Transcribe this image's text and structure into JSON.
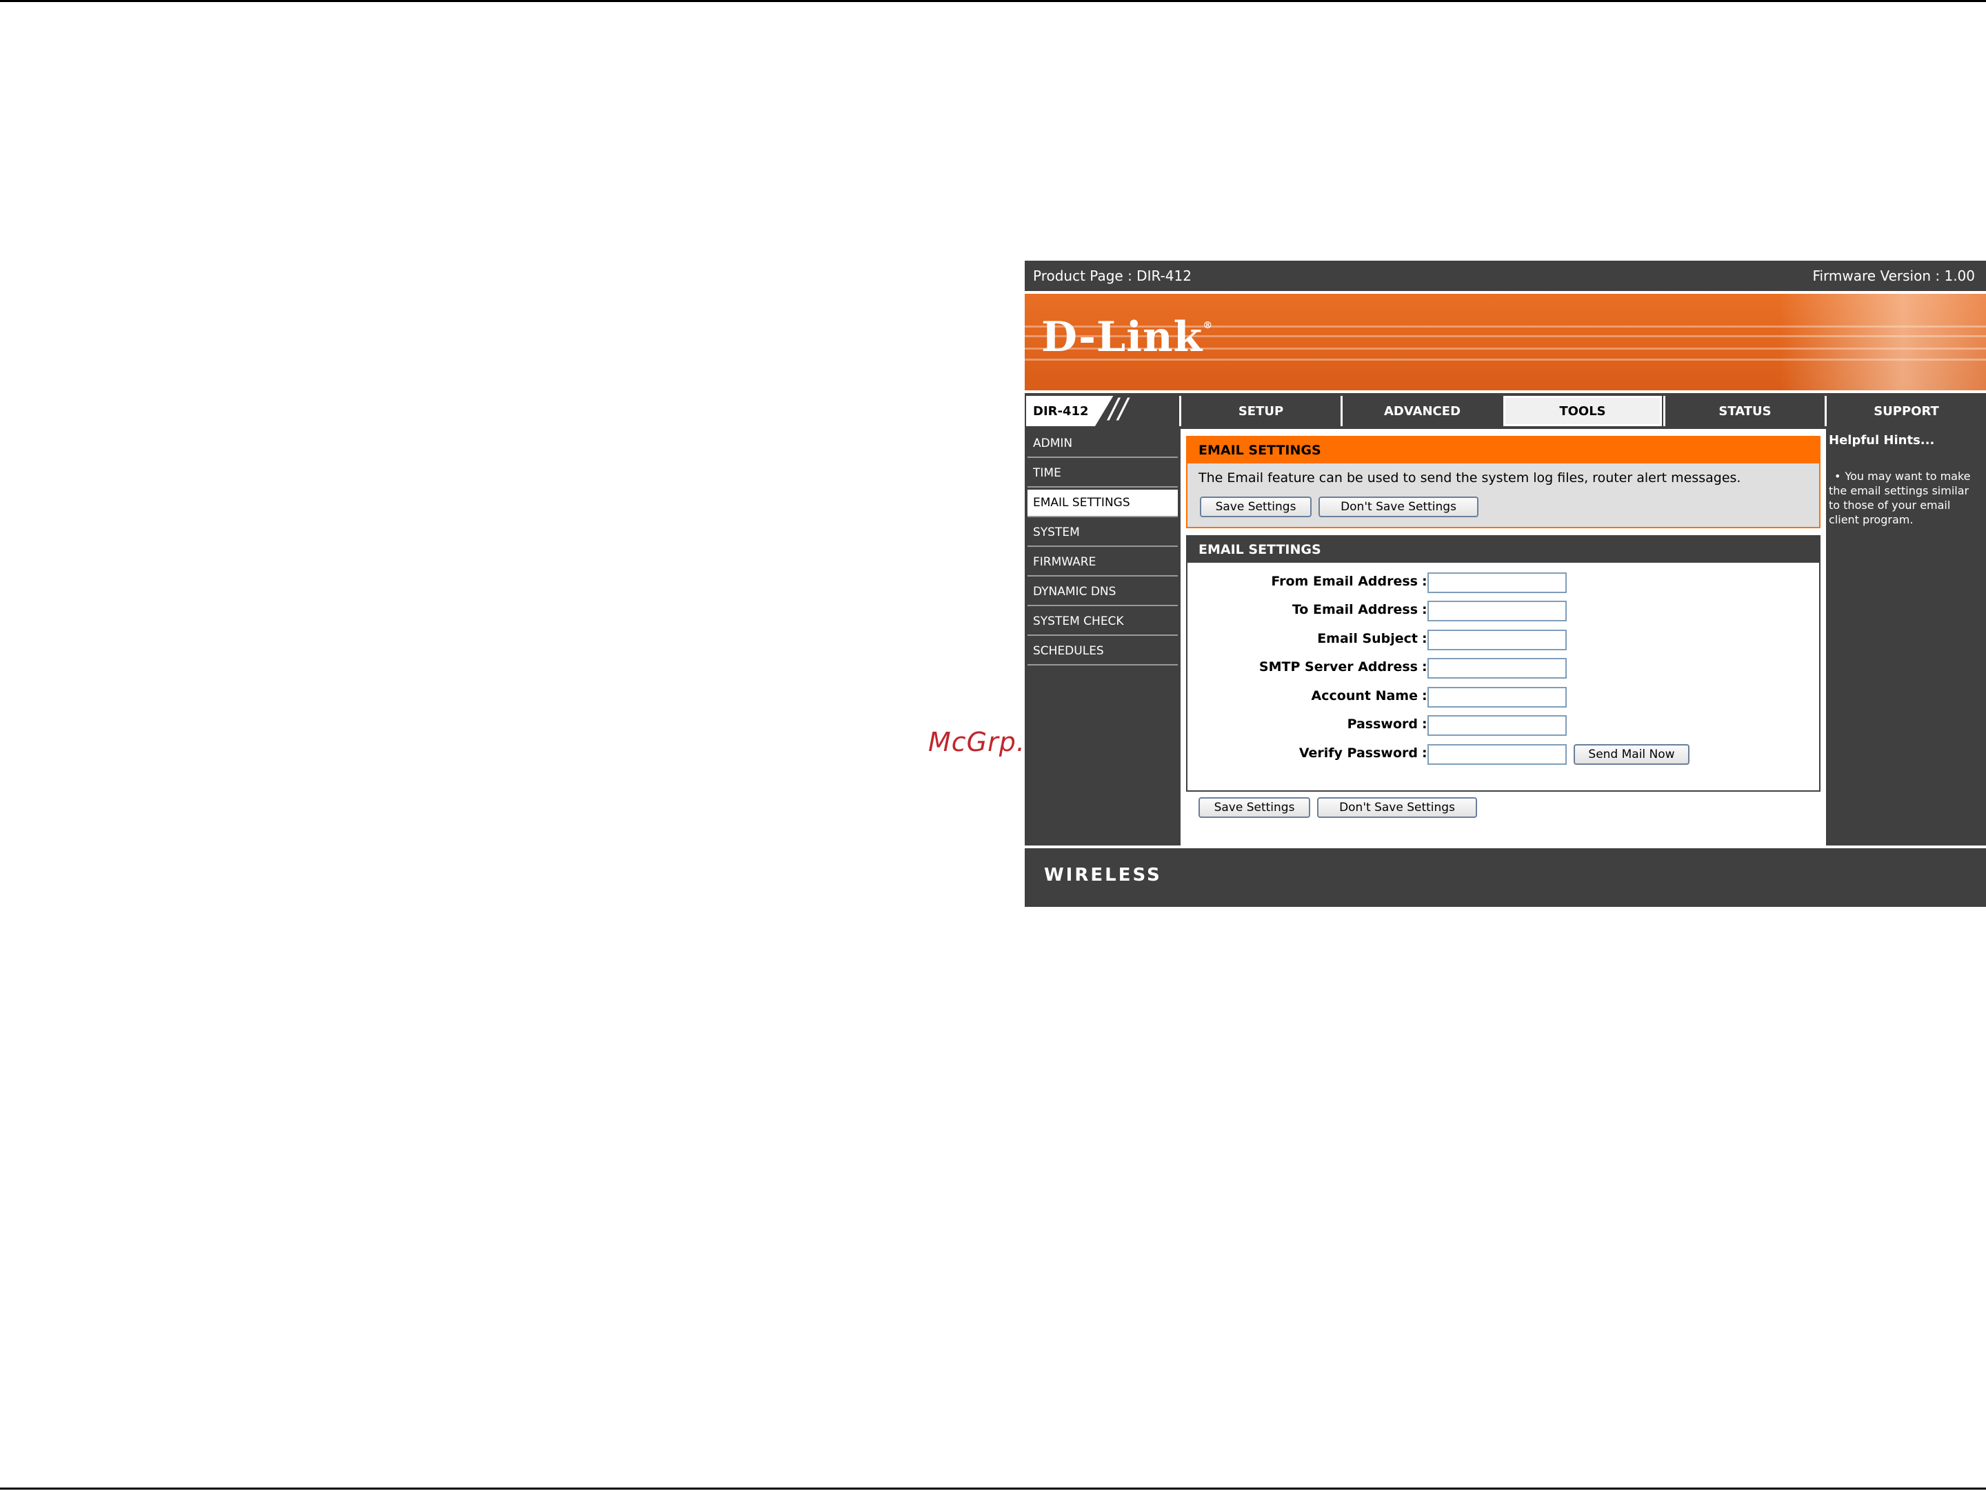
{
  "watermark": "McGrp.Ru",
  "topbar": {
    "product": "Product Page : DIR-412",
    "firmware": "Firmware Version : 1.00"
  },
  "banner": {
    "logo": "D-Link",
    "registered": "®"
  },
  "nav": {
    "model": "DIR-412",
    "model_slashes": "//",
    "tabs": [
      "SETUP",
      "ADVANCED",
      "TOOLS",
      "STATUS",
      "SUPPORT"
    ],
    "active_tab": "TOOLS"
  },
  "sidebar": {
    "items": [
      "ADMIN",
      "TIME",
      "EMAIL SETTINGS",
      "SYSTEM",
      "FIRMWARE",
      "DYNAMIC DNS",
      "SYSTEM CHECK",
      "SCHEDULES"
    ],
    "active": "EMAIL SETTINGS"
  },
  "intro": {
    "title": "EMAIL SETTINGS",
    "description": "The Email feature can be used to send the system log files, router alert messages.",
    "save_label": "Save Settings",
    "dont_save_label": "Don't Save Settings"
  },
  "form": {
    "title": "EMAIL SETTINGS",
    "colon": ":",
    "fields": [
      {
        "label": "From Email Address",
        "value": ""
      },
      {
        "label": "To Email Address",
        "value": ""
      },
      {
        "label": "Email Subject",
        "value": ""
      },
      {
        "label": "SMTP Server Address",
        "value": ""
      },
      {
        "label": "Account Name",
        "value": ""
      },
      {
        "label": "Password",
        "value": ""
      },
      {
        "label": "Verify Password",
        "value": ""
      }
    ],
    "send_mail_label": "Send Mail Now"
  },
  "bottom_buttons": {
    "save_label": "Save Settings",
    "dont_save_label": "Don't Save Settings"
  },
  "hints": {
    "title": "Helpful Hints...",
    "bullet": "•",
    "text": "You may want to make the email settings similar to those of your email client program."
  },
  "footer": {
    "label": "WIRELESS"
  },
  "colors": {
    "orange": "#ff6f00",
    "banner": "#e96f25",
    "dark": "#404040",
    "field_border": "#7f9db9"
  }
}
